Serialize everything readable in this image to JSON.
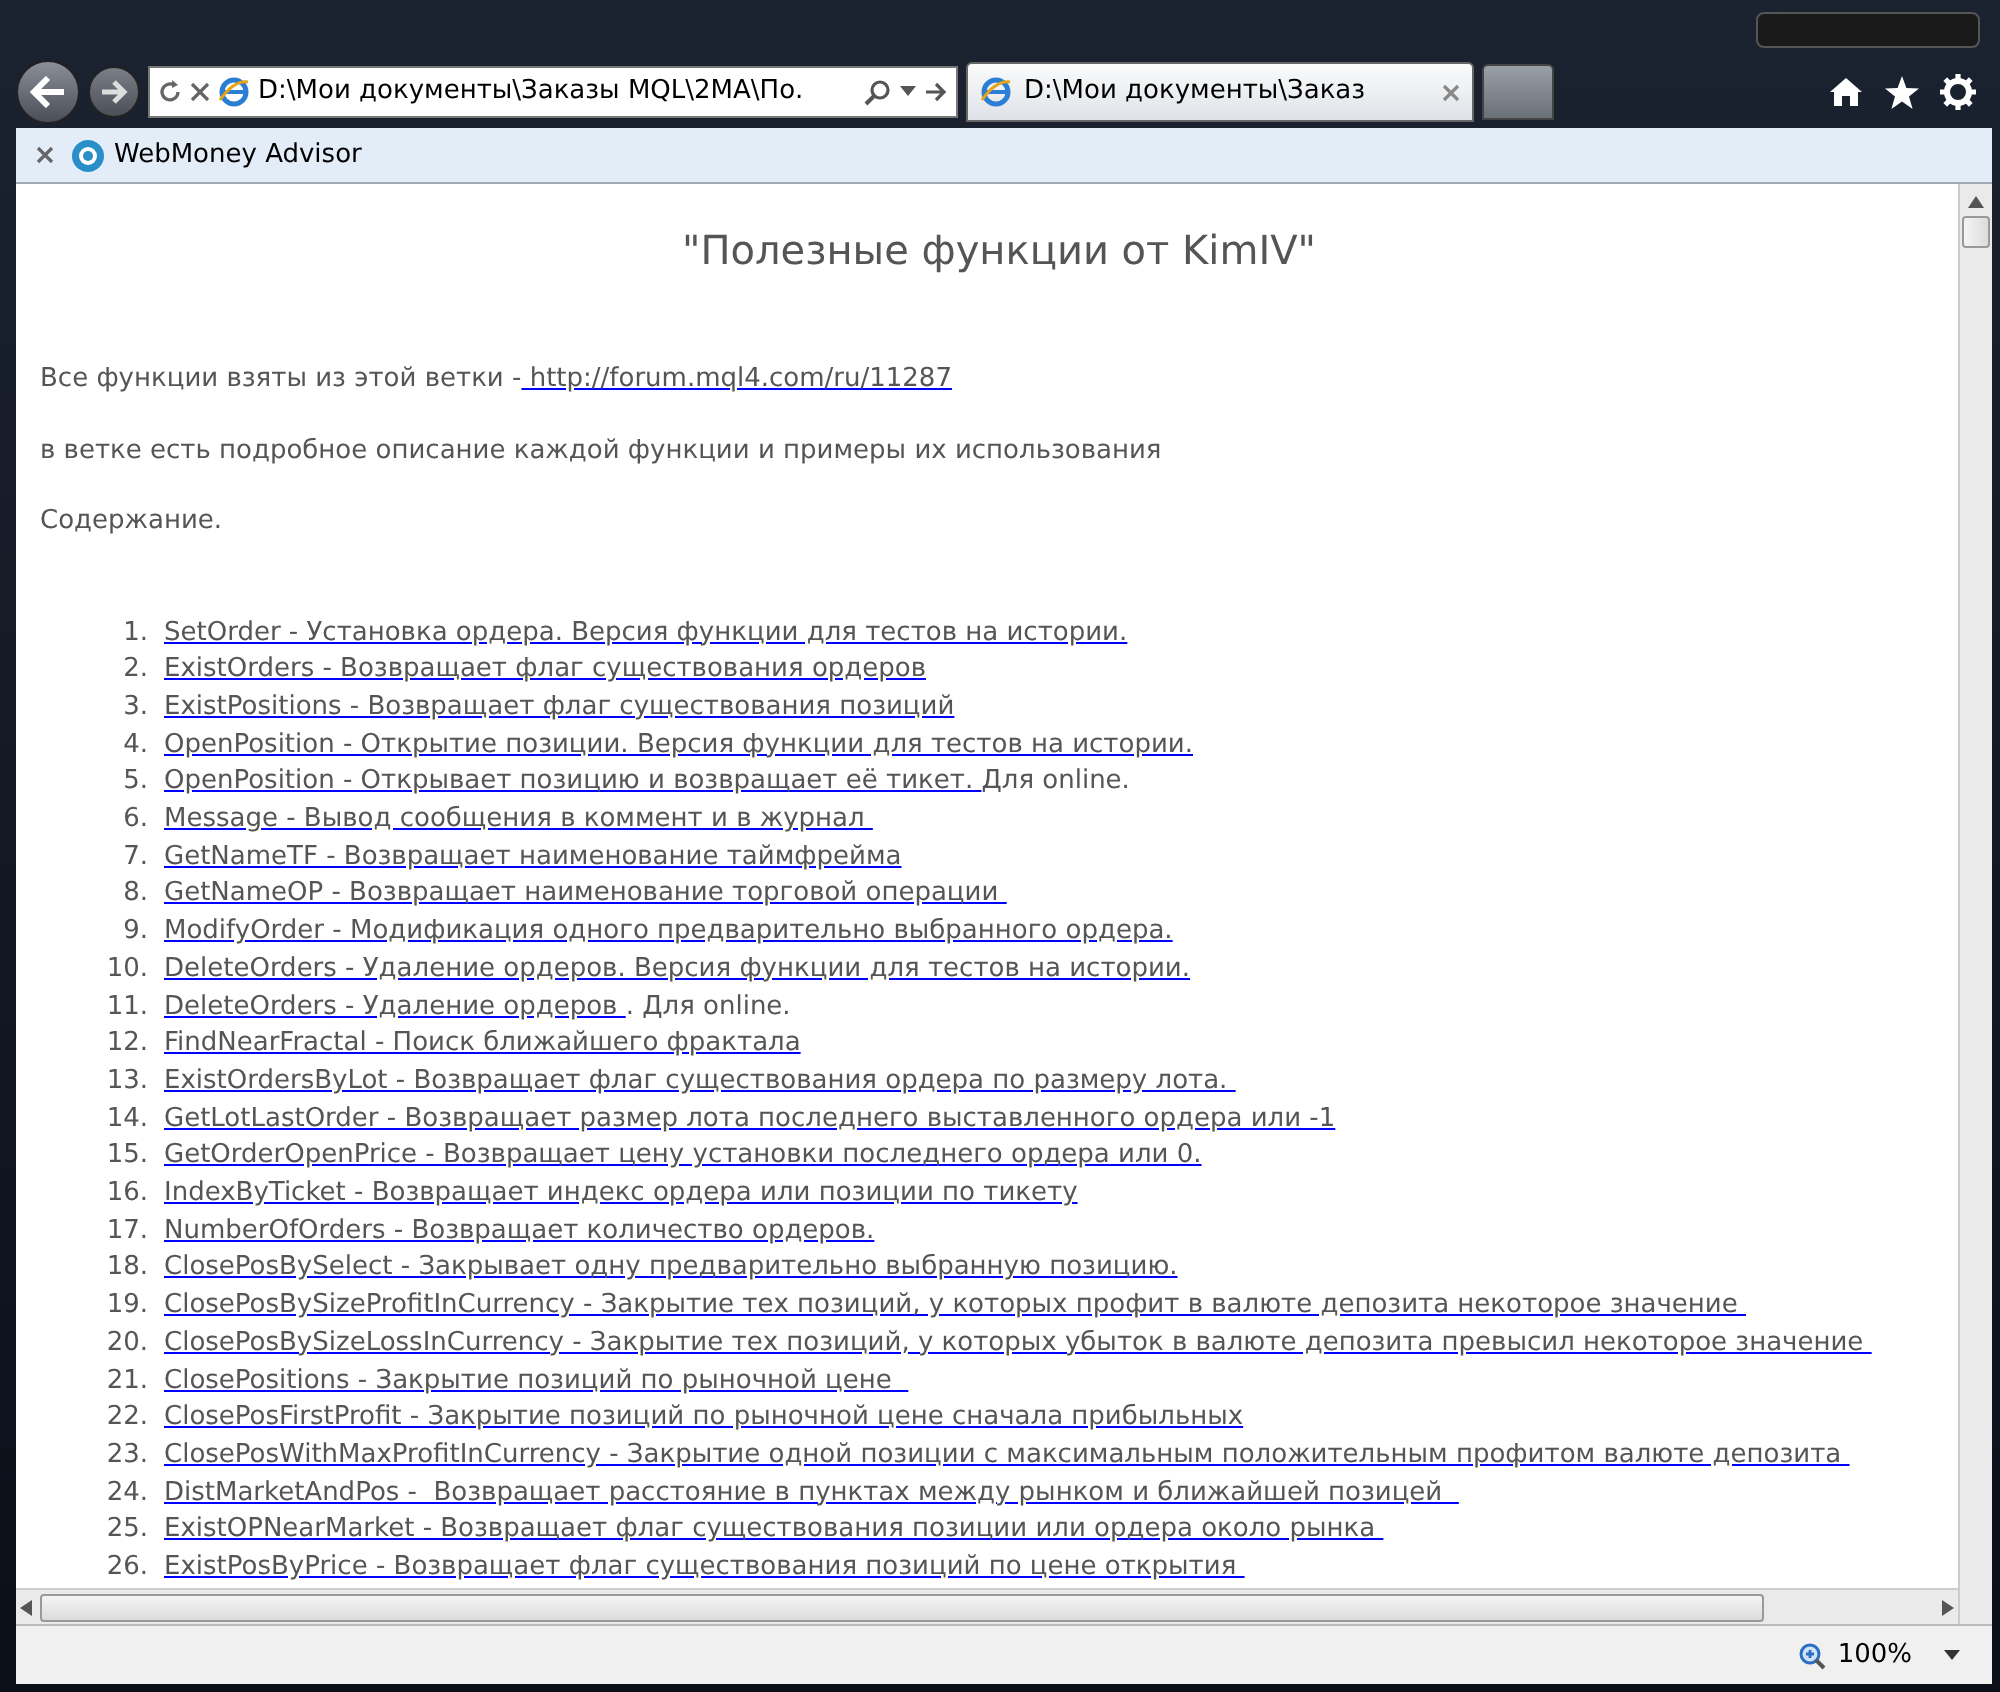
{
  "browser": {
    "address": "D:\\Мои документы\\Заказы MQL\\2MA\\По.",
    "tabs": [
      {
        "label": "D:\\Мои документы\\Заказ",
        "selected": true
      }
    ],
    "favorites_bar": [
      {
        "label": "WebMoney Advisor"
      }
    ],
    "zoom": "100%"
  },
  "page": {
    "title": "\"Полезные функции от KimIV\"",
    "source_text": "Все функции взяты из этой ветки -",
    "source_link": " http://forum.mql4.com/ru/11287",
    "description": "в ветке есть подробное описание каждой функции и примеры их использования",
    "contents_heading": "Содержание.",
    "items": [
      {
        "number": "1.",
        "link": "SetOrder - Установка ордера. Версия функции для тестов на истории."
      },
      {
        "number": "2.",
        "link": "ExistOrders - Возвращает флаг существования ордеров"
      },
      {
        "number": "3.",
        "link": "ExistPositions - Возвращает флаг существования позиций"
      },
      {
        "number": "4.",
        "link": "OpenPosition - Открытие позиции. Версия функции для тестов на истории."
      },
      {
        "number": "5.",
        "link": "OpenPosition - Открывает позицию и возвращает её тикет. ",
        "suffix": "Для online."
      },
      {
        "number": "6.",
        "link": "Message - Вывод сообщения в коммент и в журнал "
      },
      {
        "number": "7.",
        "link": "GetNameTF - Возвращает наименование таймфрейма"
      },
      {
        "number": "8.",
        "link": "GetNameOP - Возвращает наименование торговой операции "
      },
      {
        "number": "9.",
        "link": "ModifyOrder - Модификация одного предварительно выбранного ордера."
      },
      {
        "number": "10.",
        "link": "DeleteOrders - Удаление ордеров. Версия функции для тестов на истории."
      },
      {
        "number": "11.",
        "link": "DeleteOrders - Удаление ордеров ",
        "suffix": ". Для online."
      },
      {
        "number": "12.",
        "link": "FindNearFractal - Поиск ближайшего фрактала"
      },
      {
        "number": "13.",
        "link": "ExistOrdersByLot - Возвращает флаг существования ордера по размеру лота. "
      },
      {
        "number": "14.",
        "link": "GetLotLastOrder - Возвращает размер лота последнего выставленного ордера или -1"
      },
      {
        "number": "15.",
        "link": "GetOrderOpenPrice - Возвращает цену установки последнего ордера или 0."
      },
      {
        "number": "16.",
        "link": "IndexByTicket - Возвращает индекс ордера или позиции по тикету"
      },
      {
        "number": "17.",
        "link": "NumberOfOrders - Возвращает количество ордеров."
      },
      {
        "number": "18.",
        "link": "ClosePosBySelect - Закрывает одну предварительно выбранную позицию."
      },
      {
        "number": "19.",
        "link": "ClosePosBySizeProfitInCurrency - Закрытие тех позиций, у которых профит в валюте депозита некоторое значение "
      },
      {
        "number": "20.",
        "link": "ClosePosBySizeLossInCurrency - Закрытие тех позиций, у которых убыток в валюте депозита превысил некоторое значение "
      },
      {
        "number": "21.",
        "link": "ClosePositions - Закрытие позиций по рыночной цене  "
      },
      {
        "number": "22.",
        "link": "ClosePosFirstProfit - Закрытие позиций по рыночной цене сначала прибыльных"
      },
      {
        "number": "23.",
        "link": "ClosePosWithMaxProfitInCurrency - Закрытие одной позиции с максимальным положительным профитом валюте депозита "
      },
      {
        "number": "24.",
        "link": "DistMarketAndPos -  Возвращает расстояние в пунктах между рынком и ближайшей позицей  "
      },
      {
        "number": "25.",
        "link": "ExistOPNearMarket - Возвращает флаг существования позиции или ордера около рынка "
      },
      {
        "number": "26.",
        "link": "ExistPosByPrice - Возвращает флаг существования позиций по цене открытия "
      }
    ]
  }
}
